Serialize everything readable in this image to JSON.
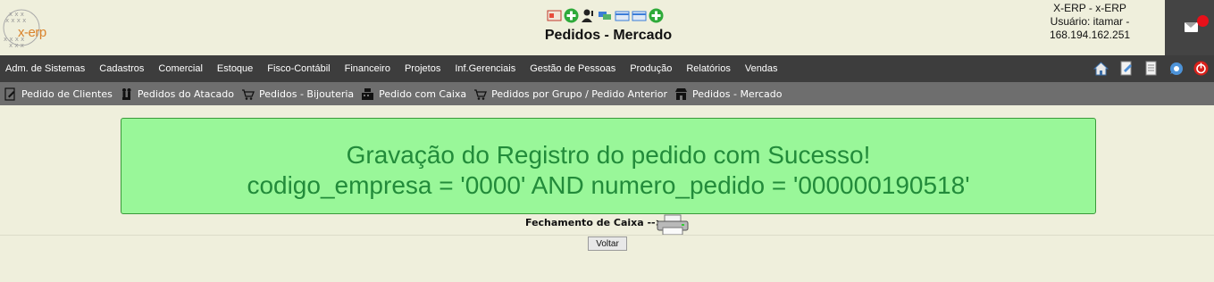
{
  "header": {
    "logo_text": "x-erp",
    "title": "Pedidos - Mercado",
    "user_line1": "X-ERP - x-ERP",
    "user_line2": "Usuário: itamar -",
    "user_line3": "168.194.162.251",
    "toolbar_icons": [
      "report-icon",
      "add-icon",
      "users-icon",
      "cards-icon",
      "card-icon",
      "card-icon",
      "add-icon"
    ]
  },
  "menu": {
    "items": [
      "Adm. de Sistemas",
      "Cadastros",
      "Comercial",
      "Estoque",
      "Fisco-Contábil",
      "Financeiro",
      "Projetos",
      "Inf.Gerenciais",
      "Gestão de Pessoas",
      "Produção",
      "Relatórios",
      "Vendas"
    ],
    "right_icons": [
      "home-icon",
      "document-edit-icon",
      "document-icon",
      "chat-icon",
      "power-icon"
    ]
  },
  "submenu": {
    "items": [
      {
        "label": "Pedido de Clientes",
        "icon": "edit-doc-icon"
      },
      {
        "label": "Pedidos do Atacado",
        "icon": "people-icon"
      },
      {
        "label": "Pedidos - Bijouteria",
        "icon": "cart-icon"
      },
      {
        "label": "Pedido com Caixa",
        "icon": "register-icon"
      },
      {
        "label": "Pedidos por Grupo / Pedido Anterior",
        "icon": "cart-icon"
      },
      {
        "label": "Pedidos - Mercado",
        "icon": "store-icon"
      }
    ]
  },
  "message": {
    "line1": "Gravação do Registro do pedido com Sucesso!",
    "line2": "codigo_empresa = '0000' AND numero_pedido = '000000190518'"
  },
  "fechamento_label": "Fechamento de Caixa -->",
  "voltar_label": "Voltar",
  "colors": {
    "background": "#efefdc",
    "menubar": "#3d3d3d",
    "submenu": "#6e6e6e",
    "success_bg": "#99f799",
    "success_text": "#228b3a",
    "notification": "#e8101a"
  }
}
